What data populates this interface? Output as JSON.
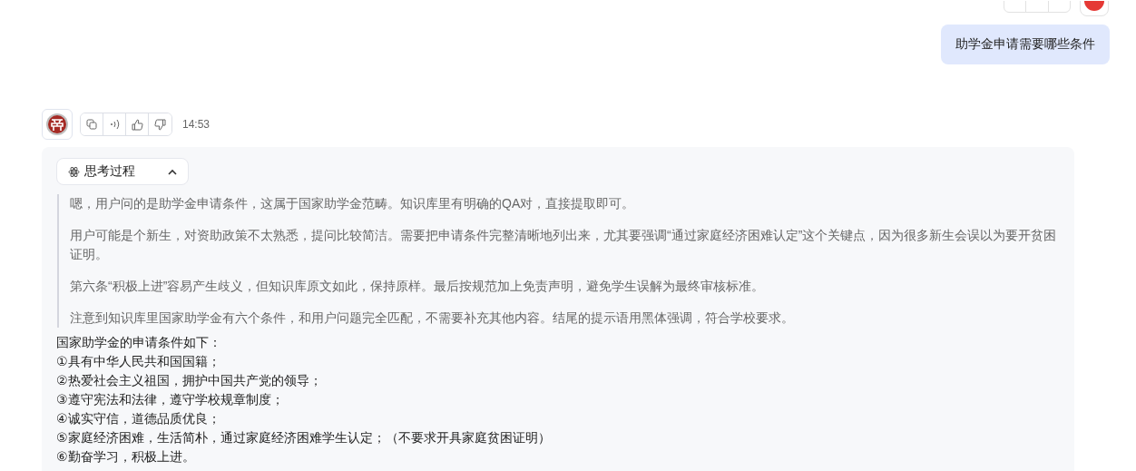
{
  "user_message": {
    "text": "助学金申请需要哪些条件"
  },
  "assistant": {
    "time": "14:53",
    "thinking": {
      "label": "思考过程",
      "expanded": true,
      "paragraphs": [
        "嗯，用户问的是助学金申请条件，这属于国家助学金范畴。知识库里有明确的QA对，直接提取即可。",
        "用户可能是个新生，对资助政策不太熟悉，提问比较简洁。需要把申请条件完整清晰地列出来，尤其要强调“通过家庭经济困难认定”这个关键点，因为很多新生会误以为要开贫困证明。",
        "第六条“积极上进”容易产生歧义，但知识库原文如此，保持原样。最后按规范加上免责声明，避免学生误解为最终审核标准。",
        "注意到知识库里国家助学金有六个条件，和用户问题完全匹配，不需要补充其他内容。结尾的提示语用黑体强调，符合学校要求。"
      ]
    },
    "answer_lines": [
      "国家助学金的申请条件如下：",
      "①具有中华人民共和国国籍；",
      "②热爱社会主义祖国，拥护中国共产党的领导；",
      "③遵守宪法和法律，遵守学校规章制度；",
      "④诚实守信，道德品质优良；",
      "⑤家庭经济困难，生活简朴，通过家庭经济困难学生认定；（不要求开具家庭贫困证明）",
      "⑥勤奋学习，积极上进。"
    ]
  }
}
